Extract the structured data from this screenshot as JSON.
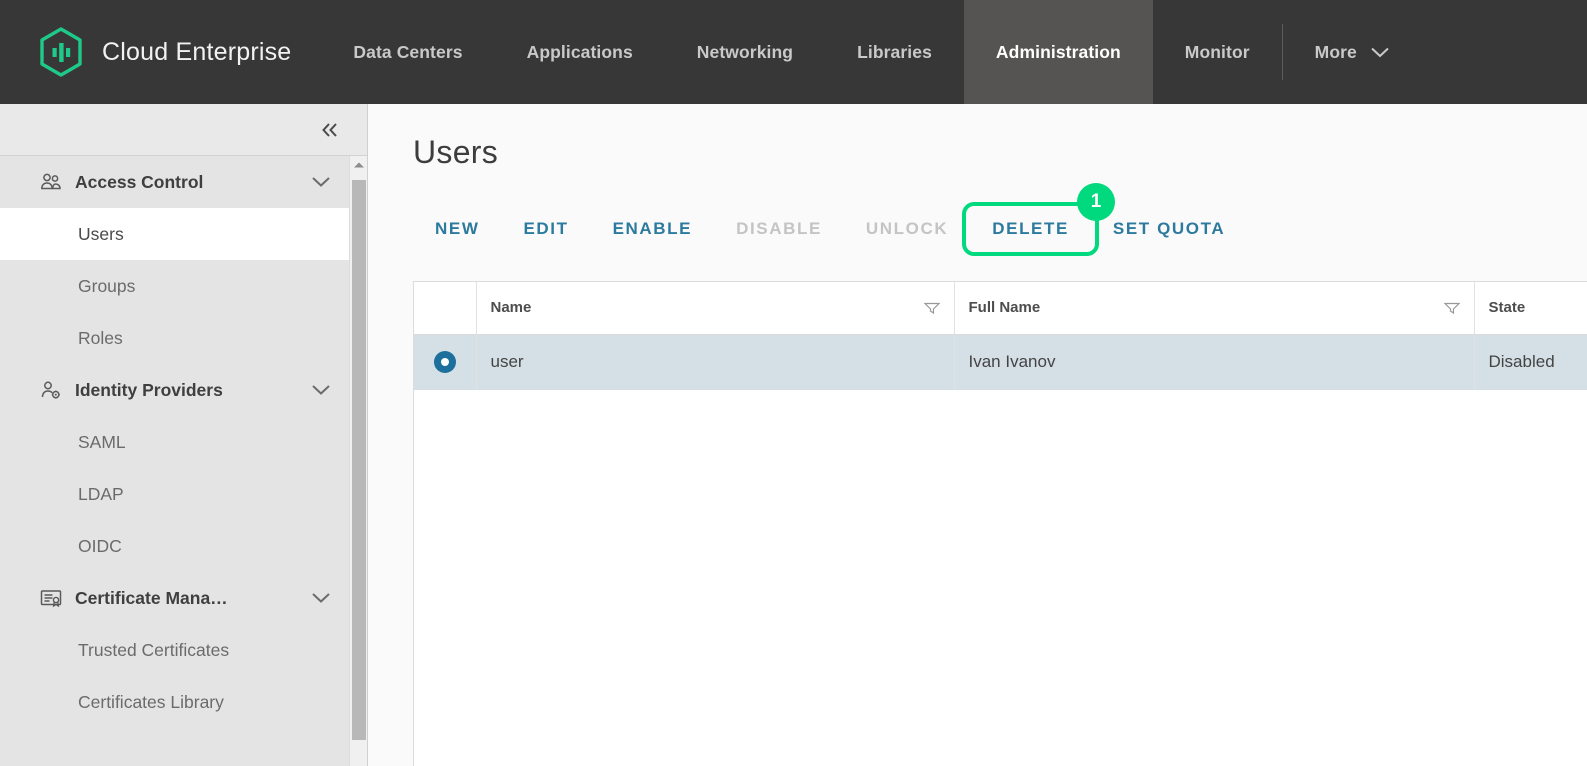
{
  "topnav": {
    "brand": "Cloud Enterprise",
    "logo_icon": "hexagon-bars-logo",
    "items": [
      {
        "label": "Data Centers",
        "active": false
      },
      {
        "label": "Applications",
        "active": false
      },
      {
        "label": "Networking",
        "active": false
      },
      {
        "label": "Libraries",
        "active": false
      },
      {
        "label": "Administration",
        "active": true
      },
      {
        "label": "Monitor",
        "active": false
      }
    ],
    "more_label": "More",
    "more_icon": "chevron-down-icon"
  },
  "sidebar": {
    "collapse_icon": "double-chevron-left-icon",
    "groups": [
      {
        "label": "Access Control",
        "icon": "users-group-icon",
        "chevron": "chevron-down-icon",
        "items": [
          {
            "label": "Users",
            "selected": true
          },
          {
            "label": "Groups",
            "selected": false
          },
          {
            "label": "Roles",
            "selected": false
          }
        ]
      },
      {
        "label": "Identity Providers",
        "icon": "user-gear-icon",
        "chevron": "chevron-down-icon",
        "items": [
          {
            "label": "SAML",
            "selected": false
          },
          {
            "label": "LDAP",
            "selected": false
          },
          {
            "label": "OIDC",
            "selected": false
          }
        ]
      },
      {
        "label": "Certificate Mana…",
        "icon": "certificate-icon",
        "chevron": "chevron-down-icon",
        "items": [
          {
            "label": "Trusted Certificates",
            "selected": false
          },
          {
            "label": "Certificates Library",
            "selected": false
          }
        ]
      }
    ],
    "scrollbar_up_icon": "caret-up-icon"
  },
  "main": {
    "page_title": "Users",
    "toolbar": [
      {
        "label": "NEW",
        "disabled": false
      },
      {
        "label": "EDIT",
        "disabled": false
      },
      {
        "label": "ENABLE",
        "disabled": false
      },
      {
        "label": "DISABLE",
        "disabled": true
      },
      {
        "label": "UNLOCK",
        "disabled": true
      },
      {
        "label": "DELETE",
        "disabled": false
      },
      {
        "label": "SET QUOTA",
        "disabled": false
      }
    ],
    "highlight": {
      "target_label": "DELETE",
      "badge": "1",
      "color": "#00d97e"
    },
    "table": {
      "columns": [
        {
          "label": "Name",
          "filter_icon": "filter-icon"
        },
        {
          "label": "Full Name",
          "filter_icon": "filter-icon"
        },
        {
          "label": "State",
          "filter_icon": null
        }
      ],
      "rows": [
        {
          "selected": true,
          "selector_icon": "radio-selected-icon",
          "name": "user",
          "full_name": "Ivan Ivanov",
          "state": "Disabled"
        }
      ]
    }
  },
  "colors": {
    "nav_bg": "#373737",
    "nav_active_bg": "#555453",
    "brand_green": "#1fc98a",
    "sidebar_bg": "#e4e4e4",
    "link_blue": "#2c7a9e",
    "row_selected_bg": "#d5e0e6",
    "highlight_green": "#00d97e"
  }
}
